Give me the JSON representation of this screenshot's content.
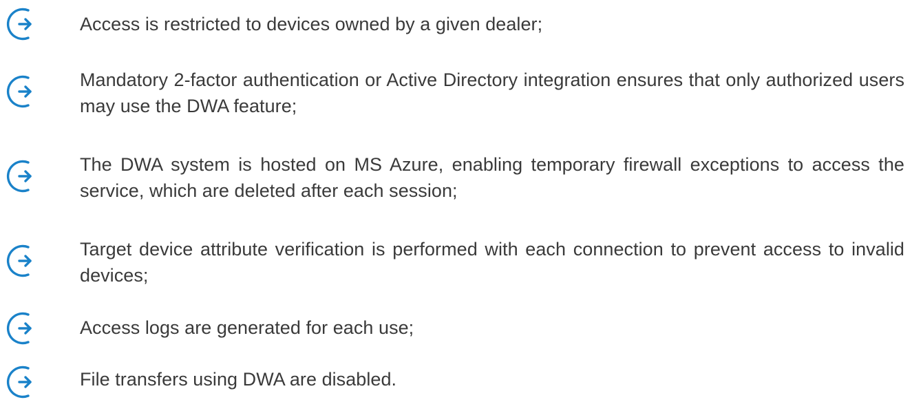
{
  "bullets": {
    "icon": "arrow-right-circle-icon",
    "icon_color": "#1a82c9",
    "text_color": "#3a3a3a",
    "items": [
      {
        "text": "Access is restricted to devices owned by a given dealer;"
      },
      {
        "text": "Mandatory 2-factor authentication or Active Directory integration ensures that only authorized users may use the DWA feature;"
      },
      {
        "text": "The DWA system is hosted on MS Azure, enabling temporary firewall exceptions to access the service, which are deleted after each session;"
      },
      {
        "text": "Target device attribute verification is performed with each connection to prevent access to invalid devices;"
      },
      {
        "text": "Access logs are generated for each use;"
      },
      {
        "text": "File transfers using DWA are disabled."
      }
    ]
  }
}
